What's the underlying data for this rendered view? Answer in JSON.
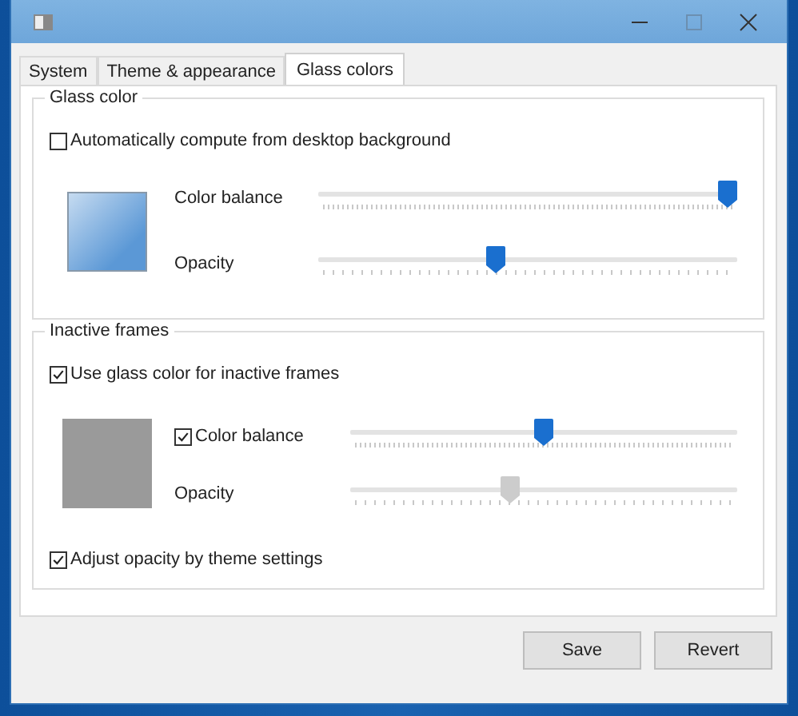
{
  "tabs": [
    {
      "label": "System",
      "selected": false
    },
    {
      "label": "Theme & appearance",
      "selected": false
    },
    {
      "label": "Glass colors",
      "selected": true
    }
  ],
  "groups": [
    {
      "title": "Glass color",
      "option": {
        "label": "Automatically compute from desktop background",
        "checked": false
      },
      "color": "#5b98d6",
      "sliders": [
        {
          "kind": "label",
          "label": "Color balance",
          "level": 1.0,
          "disabled": false
        },
        {
          "kind": "label",
          "label": "Opacity",
          "level": 0.42,
          "disabled": false
        }
      ]
    },
    {
      "title": "Inactive frames",
      "option": {
        "label": "Use glass color for inactive frames",
        "checked": true
      },
      "color": "#9a9a9a",
      "sliders": [
        {
          "kind": "checkbox",
          "label": "Color balance",
          "checked": true,
          "level": 0.5,
          "disabled": false
        },
        {
          "kind": "label",
          "label": "Opacity",
          "level": 0.41,
          "disabled": true
        }
      ],
      "extra": {
        "label": "Adjust opacity by theme settings",
        "checked": true
      }
    }
  ],
  "buttons": [
    "Save",
    "Revert"
  ]
}
